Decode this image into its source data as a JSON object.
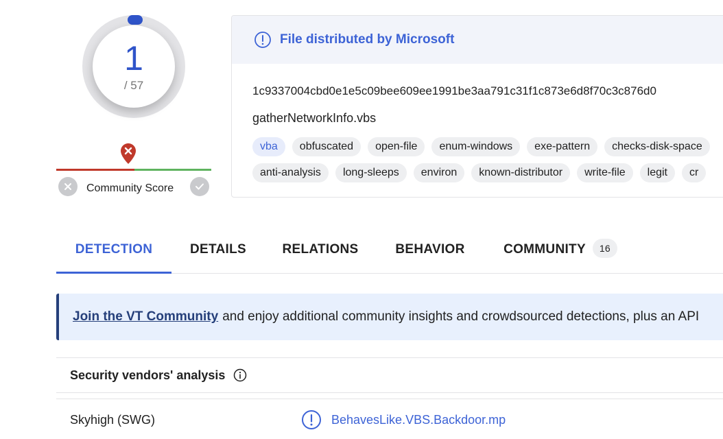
{
  "score": {
    "detections": "1",
    "total": "/ 57",
    "community_label": "Community Score"
  },
  "file_info": {
    "distributor_note": "File distributed by Microsoft",
    "hash": "1c9337004cbd0e1e5c09bee609ee1991be3aa791c31f1c873e6d8f70c3c876d0",
    "filename": "gatherNetworkInfo.vbs",
    "tags_row1": [
      "vba",
      "obfuscated",
      "open-file",
      "enum-windows",
      "exe-pattern",
      "checks-disk-space"
    ],
    "tags_row2": [
      "anti-analysis",
      "long-sleeps",
      "environ",
      "known-distributor",
      "write-file",
      "legit",
      "cr"
    ]
  },
  "tabs": [
    {
      "label": "DETECTION"
    },
    {
      "label": "DETAILS"
    },
    {
      "label": "RELATIONS"
    },
    {
      "label": "BEHAVIOR"
    },
    {
      "label": "COMMUNITY",
      "badge": "16"
    }
  ],
  "banner": {
    "link_text": "Join the VT Community",
    "text": "and enjoy additional community insights and crowdsourced detections, plus an API"
  },
  "vendors": {
    "title": "Security vendors' analysis",
    "rows": [
      {
        "vendor": "Skyhigh (SWG)",
        "result": "BehavesLike.VBS.Backdoor.mp"
      }
    ]
  },
  "colors": {
    "accent": "#3d63d6",
    "score_blue": "#2f54c9",
    "malicious_red": "#c0392b",
    "harmless_green": "#5fb35f",
    "banner_bg": "#e8f0fd"
  }
}
